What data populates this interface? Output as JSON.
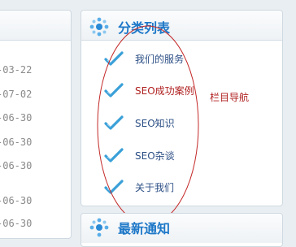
{
  "left_panel": {
    "dates": [
      "-03-22",
      "-07-02",
      "-06-30",
      "-06-30",
      "-06-30",
      "-06-30",
      "-06-30"
    ]
  },
  "category_panel": {
    "title": "分类列表",
    "icon": "blue-dots-icon",
    "items": [
      {
        "label": "我们的服务",
        "color": "#2c4f86",
        "icon": "checkmark-icon"
      },
      {
        "label": "SEO成功案例",
        "color": "#b02020",
        "icon": "checkmark-icon"
      },
      {
        "label": "SEO知识",
        "color": "#2c4f86",
        "icon": "checkmark-icon"
      },
      {
        "label": "SEO杂谈",
        "color": "#2c4f86",
        "icon": "checkmark-icon"
      },
      {
        "label": "关于我们",
        "color": "#2c4f86",
        "icon": "checkmark-icon"
      }
    ]
  },
  "annotation": {
    "text": "栏目导航",
    "color": "#b02020"
  },
  "next_panel": {
    "title": "最新通知"
  },
  "colors": {
    "accent": "#1e78c8",
    "background": "#e9eef2",
    "panel_border": "#cfd9e1"
  }
}
